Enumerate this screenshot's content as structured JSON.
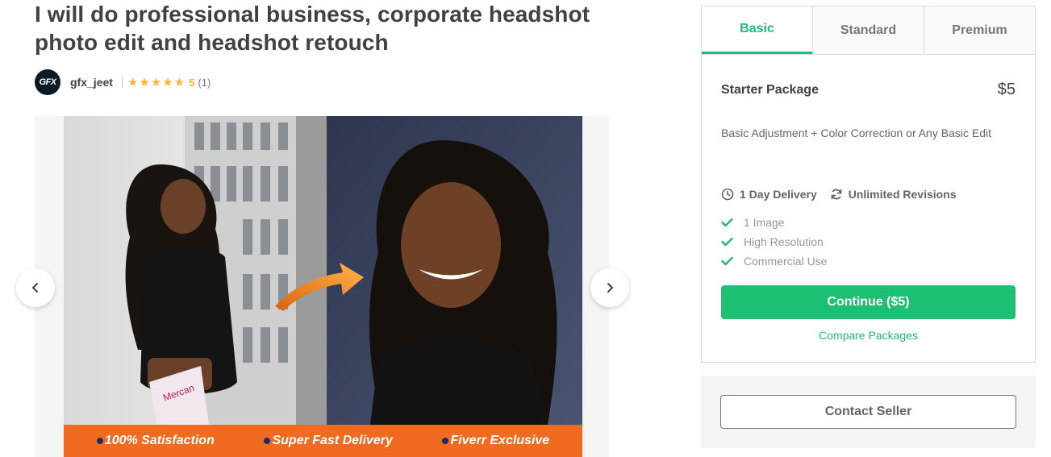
{
  "gig": {
    "title": "I will do professional business, corporate headshot photo edit and headshot retouch"
  },
  "seller": {
    "name": "gfx_jeet",
    "avatar_text": "GFX",
    "rating": "5",
    "rating_count": "(1)",
    "stars": 5
  },
  "gallery": {
    "banner": [
      "100% Satisfaction",
      "Super Fast Delivery",
      "Fiverr Exclusive"
    ],
    "prev_icon": "chevron-left-icon",
    "next_icon": "chevron-right-icon"
  },
  "package": {
    "tabs": [
      {
        "label": "Basic",
        "active": true
      },
      {
        "label": "Standard",
        "active": false
      },
      {
        "label": "Premium",
        "active": false
      }
    ],
    "name": "Starter Package",
    "price": "$5",
    "description": "Basic Adjustment + Color Correction or Any Basic Edit",
    "delivery": "1 Day Delivery",
    "revisions": "Unlimited Revisions",
    "features": [
      "1 Image",
      "High Resolution",
      "Commercial Use"
    ],
    "continue_label": "Continue ($5)",
    "compare_label": "Compare Packages"
  },
  "contact": {
    "label": "Contact Seller"
  },
  "colors": {
    "accent": "#1dbf73",
    "star": "#ffb33e",
    "banner": "#f06a1f"
  }
}
